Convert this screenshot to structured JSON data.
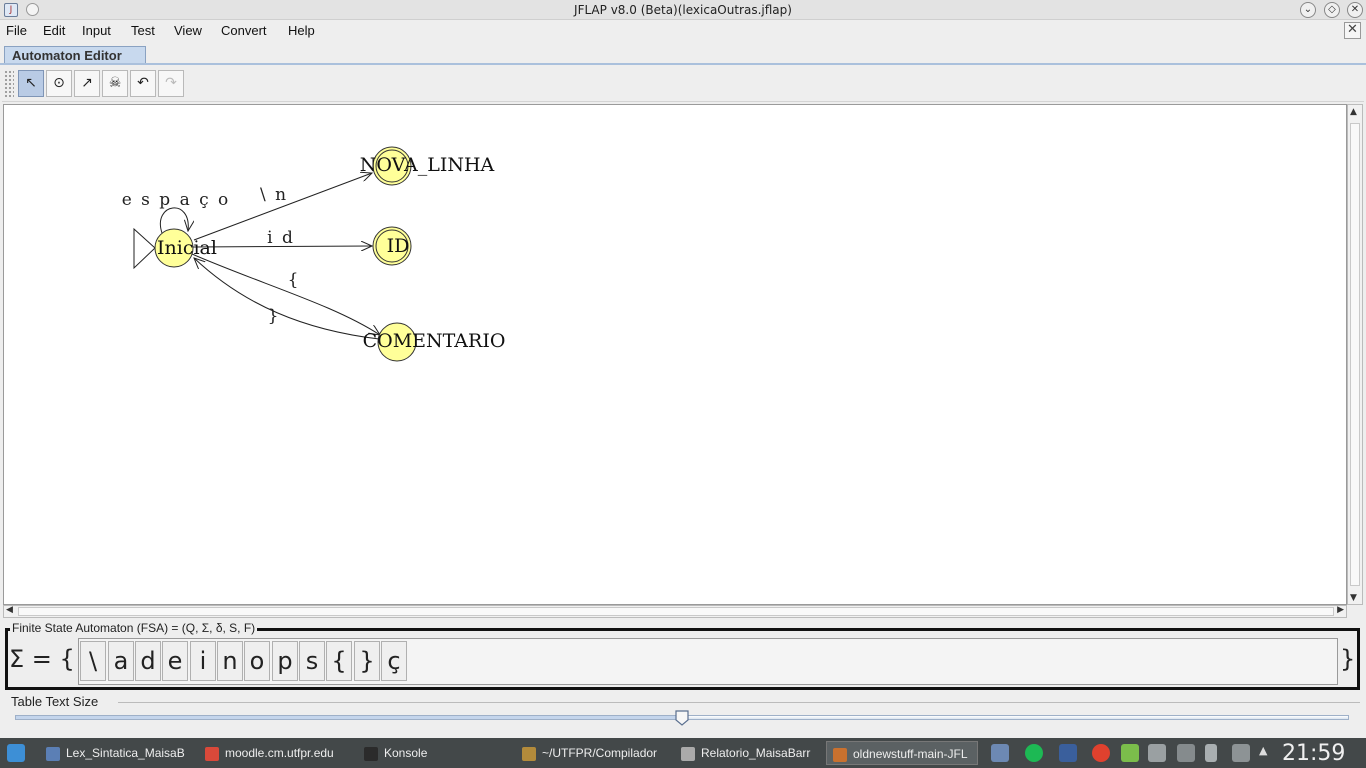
{
  "window": {
    "title": "JFLAP v8.0 (Beta)(lexicaOutras.jflap)",
    "buttons": [
      "minimize",
      "restore",
      "close"
    ]
  },
  "menu": [
    "File",
    "Edit",
    "Input",
    "Test",
    "View",
    "Convert",
    "Help"
  ],
  "tab": {
    "label": "Automaton Editor"
  },
  "toolbar": {
    "tools": [
      {
        "name": "attribute-editor-tool",
        "icon": "pointer-arrow-icon",
        "glyph": "↖",
        "active": true
      },
      {
        "name": "state-creator-tool",
        "icon": "state-circle-icon",
        "glyph": "⊙",
        "active": false
      },
      {
        "name": "transition-creator-tool",
        "icon": "transition-arrow-icon",
        "glyph": "↗",
        "active": false
      },
      {
        "name": "deleter-tool",
        "icon": "skull-icon",
        "glyph": "☠",
        "active": false
      },
      {
        "name": "undo-tool",
        "icon": "undo-icon",
        "glyph": "↶",
        "active": false
      },
      {
        "name": "redo-tool",
        "icon": "redo-icon",
        "glyph": "↷",
        "active": false
      }
    ]
  },
  "automaton": {
    "states": [
      {
        "id": "q0",
        "label": "Inicial",
        "initial": true,
        "final": false
      },
      {
        "id": "q1",
        "label": "NOVA_LINHA",
        "initial": false,
        "final": true
      },
      {
        "id": "q2",
        "label": "ID",
        "initial": false,
        "final": true
      },
      {
        "id": "q3",
        "label": "COMENTARIO",
        "initial": false,
        "final": false
      }
    ],
    "transitions": [
      {
        "from": "Inicial",
        "to": "Inicial",
        "label": "e s p a ç o"
      },
      {
        "from": "Inicial",
        "to": "NOVA_LINHA",
        "label": "\\ n"
      },
      {
        "from": "Inicial",
        "to": "ID",
        "label": "i d"
      },
      {
        "from": "Inicial",
        "to": "COMENTARIO",
        "label": "{"
      },
      {
        "from": "COMENTARIO",
        "to": "Inicial",
        "label": "}"
      }
    ],
    "colors": {
      "state_fill": "#ffff99",
      "state_stroke": "#333333"
    }
  },
  "fsa_panel": {
    "title": "Finite State Automaton (FSA) = (Q, Σ, δ, S, F)",
    "sigma_prefix": "Σ = {",
    "sigma_suffix": "}",
    "symbols": [
      "\\",
      "a",
      "d",
      "e",
      "i",
      "n",
      "o",
      "p",
      "s",
      "{",
      "}",
      "ç"
    ]
  },
  "table_text_size": {
    "label": "Table Text Size",
    "value_fraction": 0.5
  },
  "taskbar": {
    "items": [
      {
        "label": "Lex_Sintatica_MaisaB",
        "icon": "document-icon",
        "active": false
      },
      {
        "label": "moodle.cm.utfpr.edu",
        "icon": "chrome-icon",
        "active": false
      },
      {
        "label": "Konsole",
        "icon": "terminal-icon",
        "active": false
      },
      {
        "label": "~/UTFPR/Compilador",
        "icon": "editor-icon",
        "active": false
      },
      {
        "label": "Relatorio_MaisaBarr",
        "icon": "viewer-icon",
        "active": false
      },
      {
        "label": "oldnewstuff-main-JFL",
        "icon": "java-icon",
        "active": true
      }
    ],
    "clock": "21:59"
  }
}
